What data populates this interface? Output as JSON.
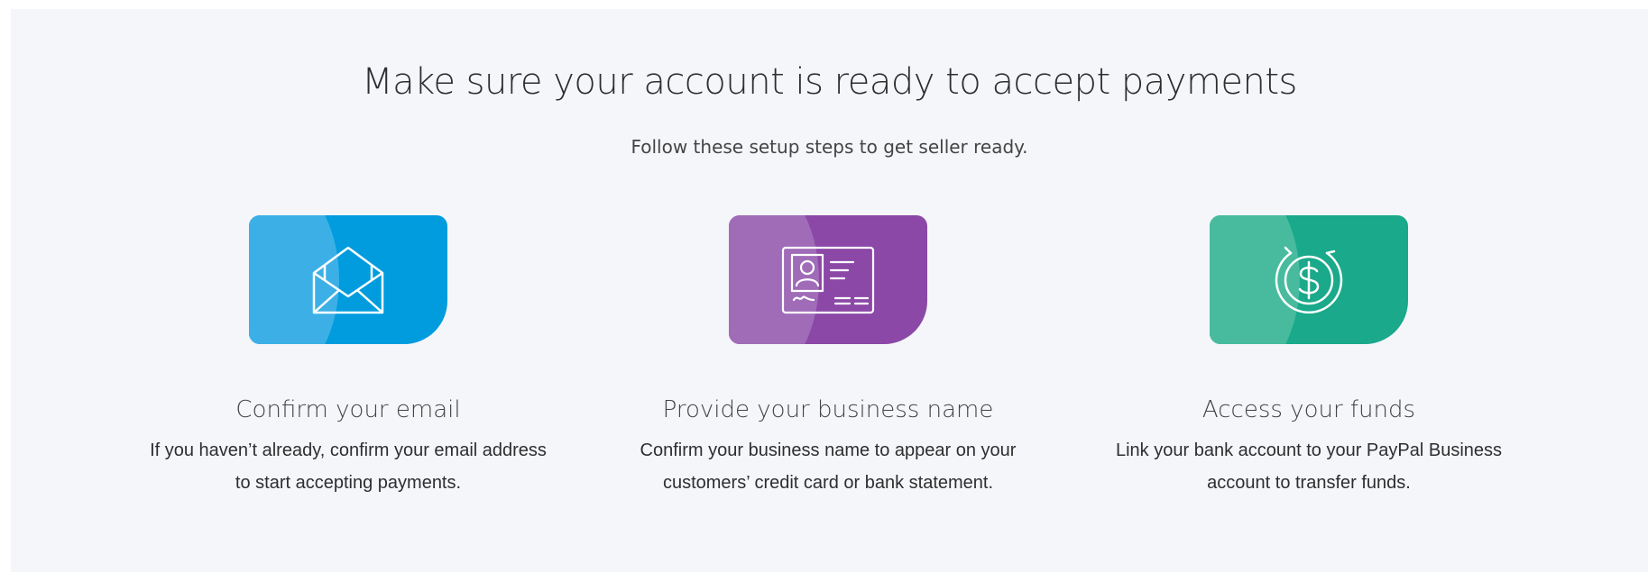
{
  "header": {
    "title": "Make sure your account is ready to accept payments",
    "subtitle": "Follow these setup steps to get seller ready."
  },
  "steps": [
    {
      "icon": "envelope-icon",
      "color": "#009cde",
      "heading": "Confirm your email",
      "text": "If you haven’t already, confirm your email address to start accepting payments."
    },
    {
      "icon": "id-card-icon",
      "color": "#8b48a7",
      "heading": "Provide your business name",
      "text": "Confirm your business name to appear on your customers’ credit card or bank statement."
    },
    {
      "icon": "dollar-icon",
      "color": "#1aa98a",
      "heading": "Access your funds",
      "text": "Link your bank account to your PayPal Business account to transfer funds."
    }
  ]
}
